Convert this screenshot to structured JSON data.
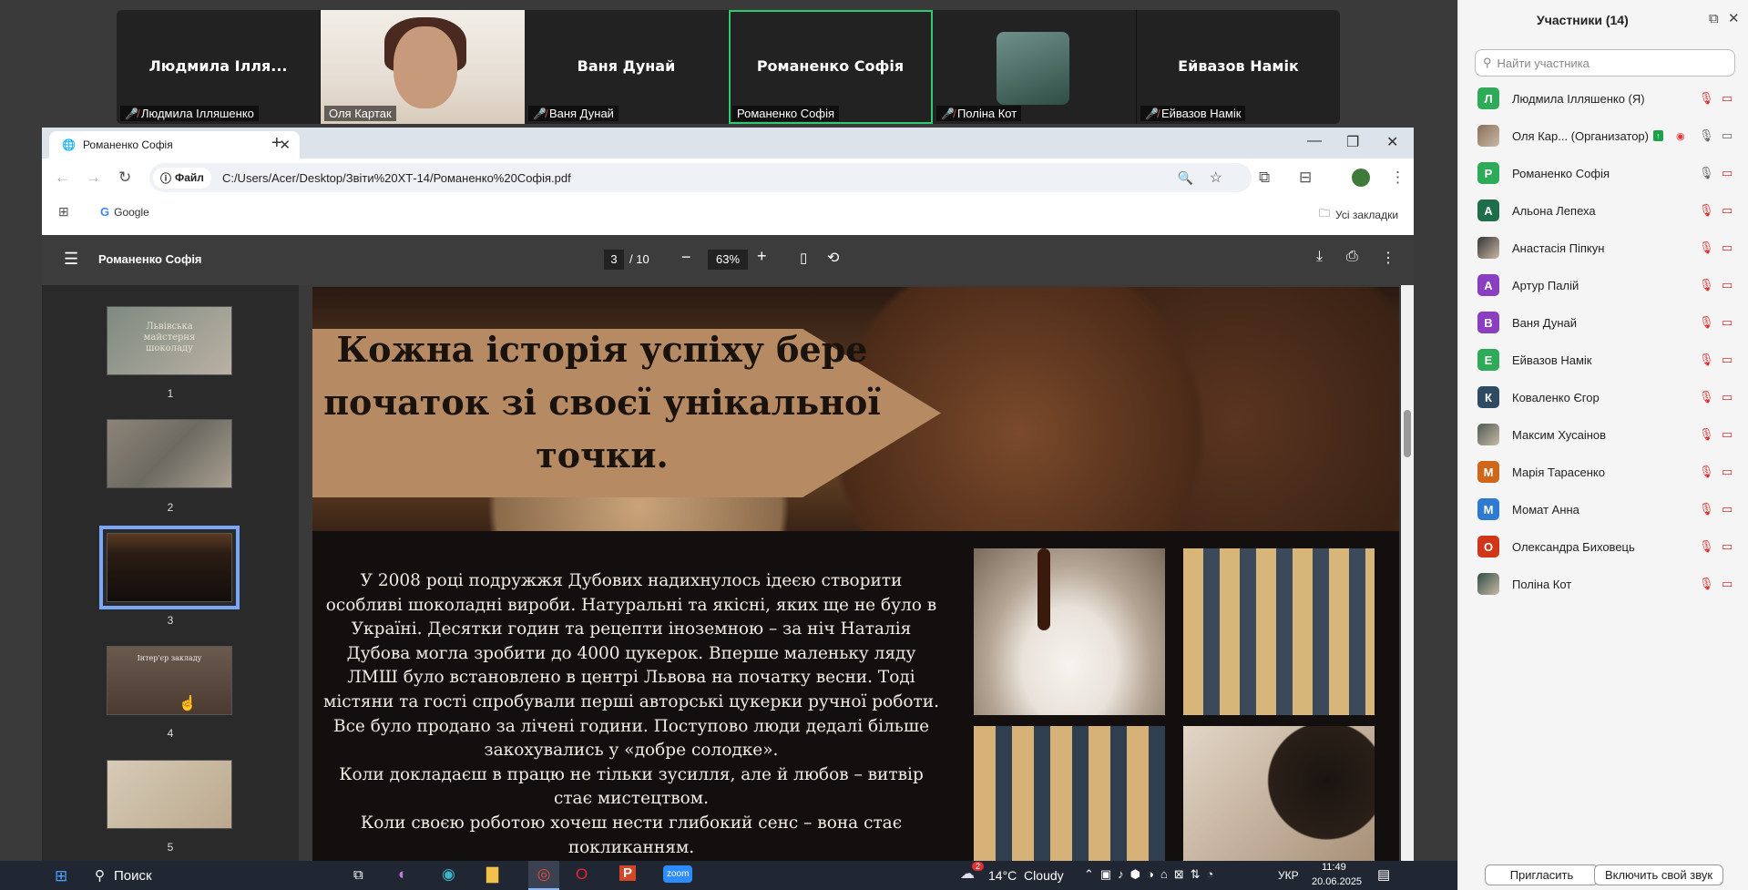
{
  "gallery": [
    {
      "center_name": "Людмила Ілля...",
      "label": "Людмила Ілляшенко",
      "muted": true,
      "kind": "text",
      "active": false
    },
    {
      "center_name": "",
      "label": "Оля Картак",
      "muted": false,
      "kind": "photo",
      "active": false
    },
    {
      "center_name": "Ваня Дунай",
      "label": "Ваня Дунай",
      "muted": true,
      "kind": "text",
      "active": false
    },
    {
      "center_name": "Романенко  Софія",
      "label": "Романенко Софія",
      "muted": false,
      "kind": "text",
      "active": true
    },
    {
      "center_name": "",
      "label": "Поліна Кот",
      "muted": true,
      "kind": "avatar",
      "active": false
    },
    {
      "center_name": "Ейвазов Намік",
      "label": "Ейвазов Намік",
      "muted": true,
      "kind": "text",
      "active": false
    }
  ],
  "browser": {
    "tab_title": "Романенко Софія",
    "chip_label": "Файл",
    "url": "C:/Users/Acer/Desktop/Звіти%20ХТ-14/Романенко%20Софія.pdf",
    "bookmark_google": "Google",
    "bookmark_all": "Усі закладки"
  },
  "pdf": {
    "doc_title": "Романенко Софія",
    "current_page": "3",
    "total_pages": "/ 10",
    "zoom": "63%",
    "thumbs": [
      "1",
      "2",
      "3",
      "4",
      "5"
    ],
    "thumb1_text": "Львівська майстерня шоколаду",
    "thumb4_text": "Інтер'єр закладу",
    "heading": "Кожна історія успіху бере початок зі своєї унікальної точки.",
    "paragraphs": [
      "У 2008 році подружжя Дубових надихнулось ідеєю створити особливі шоколадні вироби. Натуральні та якісні, яких ще не було в Україні. Десятки годин та рецепти іноземною – за ніч Наталія Дубова могла зробити до 4000 цукерок. Вперше маленьку ляду ЛМШ було встановлено в центрі Львова на початку весни. Тоді містяни та гості спробували перші авторські цукерки ручної роботи. Все було продано за лічені години. Поступово люди дедалі більше закохувались у «добре солодке».",
      "Коли докладаєш в працю не тільки зусилля, але й любов – витвір стає мистецтвом.",
      "Коли своєю роботою хочеш нести глибокий сенс – вона стає покликанням."
    ]
  },
  "participants": {
    "title": "Участники (14)",
    "search_placeholder": "Найти участника",
    "list": [
      {
        "initial": "Л",
        "name": "Людмила Ілляшенко (Я)",
        "color": "#2eaa58",
        "photo": false,
        "mic": "muted",
        "host": false
      },
      {
        "initial": "",
        "name": "Оля Кар... (Организатор)",
        "color": "#8a6f5a",
        "photo": true,
        "mic": "on",
        "host": true
      },
      {
        "initial": "Р",
        "name": "Романенко Софія",
        "color": "#2eaa58",
        "photo": false,
        "mic": "on",
        "host": false
      },
      {
        "initial": "А",
        "name": "Альона Лепеха",
        "color": "#1f6e4a",
        "photo": false,
        "mic": "muted",
        "host": false
      },
      {
        "initial": "",
        "name": "Анастасія Піпкун",
        "color": "#333333",
        "photo": true,
        "mic": "muted",
        "host": false
      },
      {
        "initial": "А",
        "name": "Артур Палій",
        "color": "#8a3fc0",
        "photo": false,
        "mic": "muted",
        "host": false
      },
      {
        "initial": "В",
        "name": "Ваня Дунай",
        "color": "#8a3fc0",
        "photo": false,
        "mic": "muted",
        "host": false
      },
      {
        "initial": "Е",
        "name": "Ейвазов Намік",
        "color": "#2eaa58",
        "photo": false,
        "mic": "muted",
        "host": false
      },
      {
        "initial": "К",
        "name": "Коваленко Єгор",
        "color": "#2f4a63",
        "photo": false,
        "mic": "muted",
        "host": false
      },
      {
        "initial": "",
        "name": "Максим Хусаінов",
        "color": "#4e5c52",
        "photo": true,
        "mic": "muted",
        "host": false
      },
      {
        "initial": "М",
        "name": "Марія Тарасенко",
        "color": "#d0661a",
        "photo": false,
        "mic": "muted",
        "host": false
      },
      {
        "initial": "М",
        "name": "Момат Анна",
        "color": "#2e7ad0",
        "photo": false,
        "mic": "muted",
        "host": false
      },
      {
        "initial": "О",
        "name": "Олександра Биховець",
        "color": "#d0361a",
        "photo": false,
        "mic": "muted",
        "host": false
      },
      {
        "initial": "",
        "name": "Поліна Кот",
        "color": "#2f4f45",
        "photo": true,
        "mic": "muted",
        "host": false
      }
    ],
    "invite_label": "Пригласить",
    "unmute_label": "Включить свой звук"
  },
  "taskbar": {
    "search_label": "Поиск",
    "weather": "14°C  Cloudy",
    "weather_badge": "2",
    "lang": "УКР",
    "time": "11:49",
    "date": "20.06.2025"
  }
}
